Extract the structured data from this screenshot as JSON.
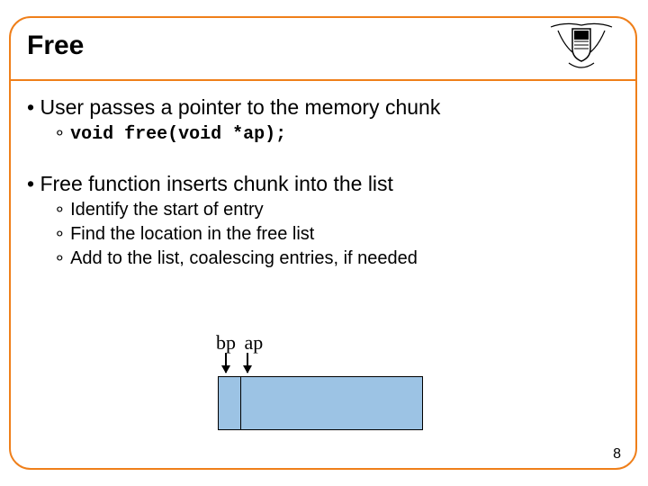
{
  "title": "Free",
  "bullets": {
    "main1": "User passes a pointer to the memory chunk",
    "code1": "void free(void *ap);",
    "main2": "Free function inserts chunk into the list",
    "sub2a": "Identify the start of entry",
    "sub2b": "Find the location in the free list",
    "sub2c": "Add to the list, coalescing entries, if needed"
  },
  "diagram": {
    "label_bp": "bp",
    "label_ap": "ap"
  },
  "page_number": "8",
  "colors": {
    "border": "#ef7f1a",
    "chunk_fill": "#9cc3e4"
  }
}
